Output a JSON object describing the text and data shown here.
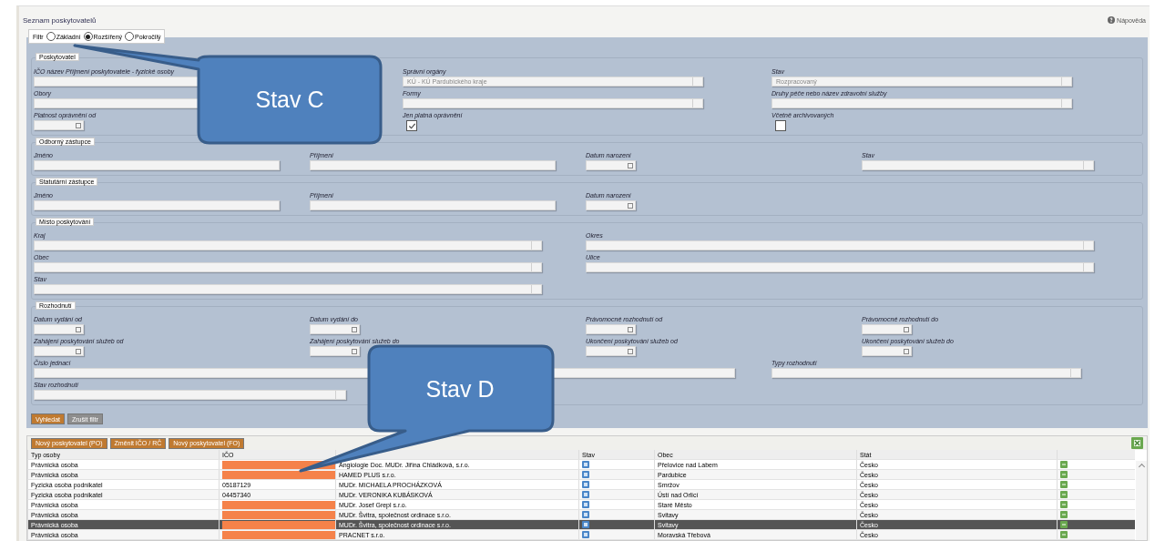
{
  "page": {
    "title": "Seznam poskytovatelů",
    "help": "Nápověda"
  },
  "filter": {
    "label": "Filtr",
    "options": [
      {
        "label": "Základní",
        "selected": false
      },
      {
        "label": "Rozšířený",
        "selected": true
      },
      {
        "label": "Pokročilý",
        "selected": false
      }
    ]
  },
  "fieldsets": [
    {
      "legend": "Poskytovatel",
      "rows": [
        [
          {
            "kind": "text",
            "label": "IČO název Příjmení poskytovatele - fyzické osoby"
          },
          {
            "kind": "select",
            "label": "Správní orgány",
            "value": "KÚ - KÚ Pardubického kraje"
          },
          {
            "kind": "select",
            "label": "Stav",
            "value": "Rozpracovaný"
          }
        ],
        [
          {
            "kind": "select",
            "label": "Obory"
          },
          {
            "kind": "select",
            "label": "Formy"
          },
          {
            "kind": "select",
            "label": "Druhy péče nebo název zdravotní služby"
          }
        ],
        [
          {
            "kind": "date",
            "label": "Platnost oprávnění od"
          },
          {
            "kind": "checkbox",
            "label": "Jen platná oprávnění",
            "checked": true
          },
          {
            "kind": "checkbox",
            "label": "Včetně archivovaných",
            "checked": false
          }
        ]
      ]
    },
    {
      "legend": "Odborný zástupce",
      "rows": [
        [
          {
            "kind": "text",
            "label": "Jméno"
          },
          {
            "kind": "text",
            "label": "Příjmení"
          },
          {
            "kind": "date",
            "label": "Datum narození"
          },
          {
            "kind": "select",
            "label": "Stav"
          }
        ]
      ]
    },
    {
      "legend": "Statutární zástupce",
      "rows": [
        [
          {
            "kind": "text",
            "label": "Jméno"
          },
          {
            "kind": "text",
            "label": "Příjmení"
          },
          {
            "kind": "date",
            "label": "Datum narození"
          }
        ]
      ]
    },
    {
      "legend": "Místo poskytování",
      "rows": [
        [
          {
            "kind": "select",
            "label": "Kraj"
          },
          {
            "kind": "select",
            "label": "Okres"
          }
        ],
        [
          {
            "kind": "select",
            "label": "Obec"
          },
          {
            "kind": "select",
            "label": "Ulice"
          }
        ],
        [
          {
            "kind": "select",
            "label": "Stav"
          }
        ]
      ]
    },
    {
      "legend": "Rozhodnutí",
      "rows": [
        [
          {
            "kind": "date",
            "label": "Datum vydání od"
          },
          {
            "kind": "date",
            "label": "Datum vydání do"
          },
          {
            "kind": "date",
            "label": "Právomocné rozhodnutí od"
          },
          {
            "kind": "date",
            "label": "Právomocné rozhodnutí do"
          }
        ],
        [
          {
            "kind": "date",
            "label": "Zahájení poskytování služeb od"
          },
          {
            "kind": "date",
            "label": "Zahájení poskytování služeb do"
          },
          {
            "kind": "date",
            "label": "Ukončení poskytování služeb od"
          },
          {
            "kind": "date",
            "label": "Ukončení poskytování služeb do"
          }
        ]
      ],
      "other_fields": [
        {
          "kind": "text",
          "label": "Číslo jednací"
        },
        {
          "kind": "select",
          "label": "Typy rozhodnutí"
        },
        {
          "kind": "select",
          "label": "Stav rozhodnutí"
        }
      ]
    }
  ],
  "form_buttons": [
    {
      "label": "Vyhledat",
      "kind": "primary"
    },
    {
      "label": "Zrušit filtr",
      "kind": "secondary"
    }
  ],
  "toolbar": [
    "Nový poskytovatel (PO)",
    "Změnit IČO / RČ",
    "Nový poskytovatel (FO)"
  ],
  "table": {
    "columns": [
      "Typ osoby",
      "IČO",
      "Stav",
      "Obec",
      "Stát"
    ],
    "rows": [
      {
        "type": "Právnická osoba",
        "ico_redacted": true,
        "name": "Angiologie Doc. MUDr. Jiřina Chládková, s.r.o.",
        "city": "Přelovice nad Labem",
        "country": "Česko",
        "selected": false
      },
      {
        "type": "Právnická osoba",
        "ico_redacted": true,
        "name": "HAMED PLUS s.r.o.",
        "city": "Pardubice",
        "country": "Česko",
        "selected": false
      },
      {
        "type": "Fyzická osoba podnikatel",
        "ico": "05187129",
        "ico_redacted": false,
        "name": "MUDr. MICHAELA PROCHÁZKOVÁ",
        "city": "Smržov",
        "country": "Česko",
        "selected": false
      },
      {
        "type": "Fyzická osoba podnikatel",
        "ico": "04457340",
        "ico_redacted": false,
        "name": "MUDr. VERONIKA KUBÁSKOVÁ",
        "city": "Ústí nad Orlicí",
        "country": "Česko",
        "selected": false
      },
      {
        "type": "Právnická osoba",
        "ico_redacted": true,
        "name": "MUDr. Josef Grepl s.r.o.",
        "city": "Staré Město",
        "country": "Česko",
        "selected": false
      },
      {
        "type": "Právnická osoba",
        "ico_redacted": true,
        "name": "MUDr. Švitra, společnost ordinace s.r.o.",
        "city": "Svitavy",
        "country": "Česko",
        "selected": false
      },
      {
        "type": "Právnická osoba",
        "ico_redacted": true,
        "name": "MUDr. Švitra, společnost ordinace s.r.o.",
        "city": "Svitavy",
        "country": "Česko",
        "selected": true
      },
      {
        "type": "Právnická osoba",
        "ico_redacted": true,
        "name": "PRACNET s.r.o.",
        "city": "Moravská Třebová",
        "country": "Česko",
        "selected": false
      }
    ]
  },
  "callouts": [
    {
      "text": "Stav C"
    },
    {
      "text": "Stav D"
    }
  ]
}
